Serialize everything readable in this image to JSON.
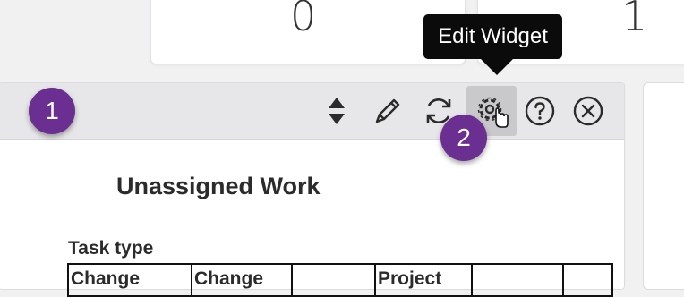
{
  "stats": {
    "left_value": "0",
    "right_value": "1"
  },
  "tooltip": {
    "text": "Edit Widget"
  },
  "badges": {
    "step1": "1",
    "step2": "2",
    "color": "#6b2e91"
  },
  "toolbar": {
    "icons": [
      "sort-icon",
      "pencil-icon",
      "refresh-icon",
      "gear-icon",
      "help-icon",
      "close-circle-icon"
    ]
  },
  "widget": {
    "title": "Unassigned Work",
    "section_label": "Task type",
    "table_headers": [
      "Change",
      "Change",
      "",
      "Project",
      "",
      ""
    ]
  }
}
